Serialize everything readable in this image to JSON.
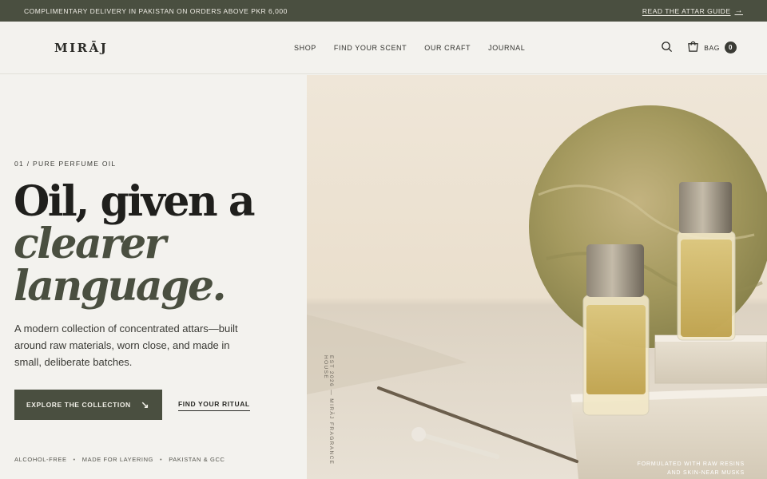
{
  "announcement": {
    "text": "COMPLIMENTARY DELIVERY IN PAKISTAN ON ORDERS ABOVE PKR 6,000",
    "link": "READ THE ATTAR GUIDE",
    "arrow": "→"
  },
  "header": {
    "logo": "MIRĀJ",
    "nav": [
      "SHOP",
      "FIND YOUR SCENT",
      "OUR CRAFT",
      "JOURNAL"
    ],
    "bag_label": "BAG",
    "bag_count": "0"
  },
  "hero": {
    "eyebrow": "01 / PURE PERFUME OIL",
    "headline_line1": "Oil, given a",
    "headline_line2": "clearer",
    "headline_line3": "language.",
    "description": "A modern collection of concentrated attars—built around raw materials, worn close, and made in small, deliberate batches.",
    "cta_label": "EXPLORE THE COLLECTION",
    "cta_arrow": "↘",
    "secondary_label": "FIND YOUR RITUAL",
    "badges": [
      "ALCOHOL-FREE",
      "MADE FOR LAYERING",
      "PAKISTAN & GCC"
    ],
    "vertical_text": "EST 2026 — MIRĀJ FRAGRANCE HOUSE",
    "formulated_line1": "FORMULATED WITH RAW RESINS",
    "formulated_line2": "AND SKIN-NEAR MUSKS"
  },
  "colors": {
    "accent": "#4a4f40",
    "background": "#f3f2ee"
  }
}
